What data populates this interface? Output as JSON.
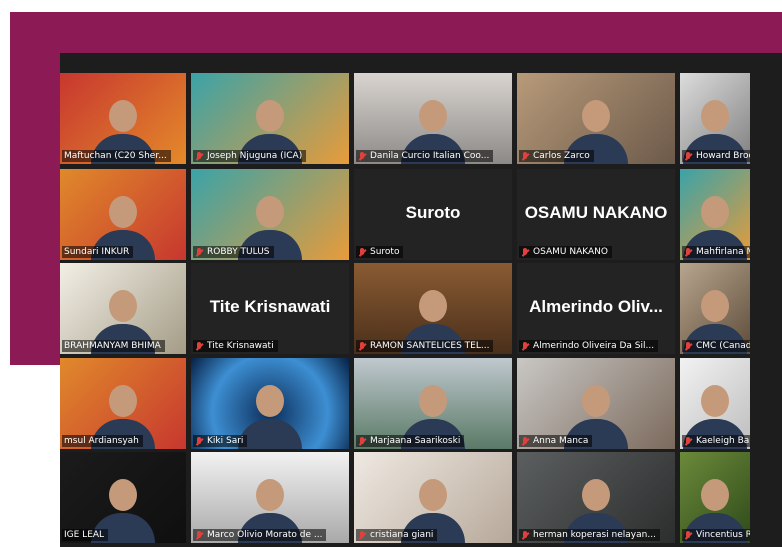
{
  "participants": [
    {
      "label": "Maftuchan (C20 Sher...",
      "muted": false,
      "video": true,
      "bg": "linear-gradient(135deg,#c7372f,#e48a2a)"
    },
    {
      "label": "Joseph Njuguna (ICA)",
      "muted": true,
      "video": true,
      "bg": "linear-gradient(135deg,#3aa3a8,#e89b3a)"
    },
    {
      "label": "Danila Curcio Italian Coo...",
      "muted": true,
      "video": true,
      "bg": "linear-gradient(180deg,#d9d4cf,#8c8a88)"
    },
    {
      "label": "Carlos Zarco",
      "muted": true,
      "video": true,
      "bg": "linear-gradient(135deg,#b79a79,#6c5a4a)"
    },
    {
      "label": "Howard Brodsky",
      "muted": true,
      "video": true,
      "bg": "linear-gradient(135deg,#dcdcdc,#7f7f7f)"
    },
    {
      "label": "Sundari INKUR",
      "muted": false,
      "video": true,
      "bg": "linear-gradient(135deg,#e0892b,#c7372f)"
    },
    {
      "label": "ROBBY TULUS",
      "muted": true,
      "video": true,
      "bg": "linear-gradient(135deg,#3aa3a8,#e89b3a)"
    },
    {
      "label": "Suroto",
      "muted": true,
      "video": false,
      "name": "Suroto"
    },
    {
      "label": "OSAMU NAKANO",
      "muted": true,
      "video": false,
      "name": "OSAMU NAKANO"
    },
    {
      "label": "Mahfirlana Masha...",
      "muted": true,
      "video": true,
      "bg": "linear-gradient(135deg,#3aa3a8,#e89b3a)"
    },
    {
      "label": "BRAHMANYAM BHIMA",
      "muted": false,
      "video": true,
      "bg": "linear-gradient(135deg,#f2efe6,#a49c86)"
    },
    {
      "label": "Tite Krisnawati",
      "muted": true,
      "video": false,
      "name": "Tite Krisnawati"
    },
    {
      "label": "RAMON SANTELICES TEL...",
      "muted": true,
      "video": true,
      "bg": "linear-gradient(180deg,#8a5b33,#4a2f1a)"
    },
    {
      "label": "Almerindo Oliveira Da Sil...",
      "muted": true,
      "video": false,
      "name": "Almerindo Oliv..."
    },
    {
      "label": "CMC (Canada) - D...",
      "muted": true,
      "video": true,
      "bg": "linear-gradient(135deg,#b8a58e,#5c4c3a)"
    },
    {
      "label": "msul Ardiansyah",
      "muted": false,
      "video": true,
      "bg": "linear-gradient(135deg,#e0892b,#c7372f)"
    },
    {
      "label": "Kiki Sari",
      "muted": true,
      "video": true,
      "bg": "radial-gradient(circle at 50% 60%,#0c2e5a,#3d8fd3 60%,#062043)"
    },
    {
      "label": "Marjaana Saarikoski",
      "muted": true,
      "video": true,
      "bg": "linear-gradient(180deg,#bfc8ce,#5a7a66)"
    },
    {
      "label": "Anna Manca",
      "muted": true,
      "video": true,
      "bg": "linear-gradient(135deg,#c9c7c4,#7b6a5c)"
    },
    {
      "label": "Kaeleigh Barker -",
      "muted": true,
      "video": true,
      "bg": "linear-gradient(135deg,#f2f2f2,#bdbdbd)"
    },
    {
      "label": "IGE LEAL",
      "muted": false,
      "video": true,
      "bg": "linear-gradient(135deg,#1b1b1b,#0f0f0f)"
    },
    {
      "label": "Marco Olivio Morato de ...",
      "muted": true,
      "video": true,
      "bg": "linear-gradient(180deg,#f2f2f2,#a9a9a9)"
    },
    {
      "label": "cristiana giani",
      "muted": true,
      "video": true,
      "bg": "linear-gradient(135deg,#efe9e2,#b7a99a)"
    },
    {
      "label": "herman koperasi nelayan...",
      "muted": true,
      "video": true,
      "bg": "linear-gradient(135deg,#5c5f5f,#2c2e2e)"
    },
    {
      "label": "Vincentius Repu",
      "muted": true,
      "video": true,
      "bg": "linear-gradient(135deg,#6b8a3a,#2f4a1a)"
    }
  ]
}
